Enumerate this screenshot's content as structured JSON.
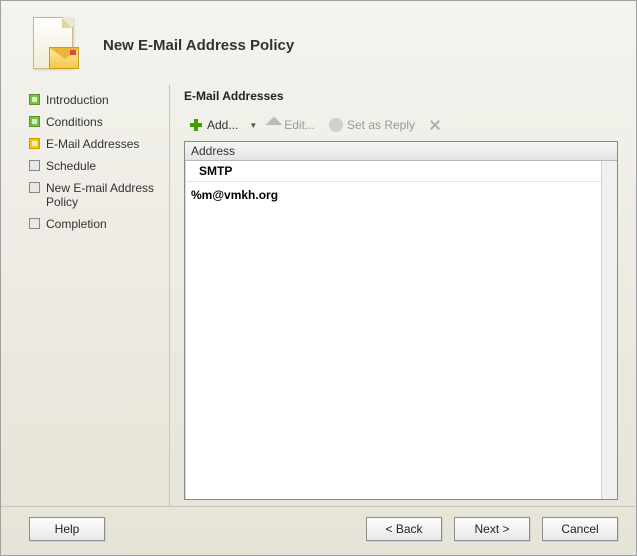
{
  "header": {
    "title": "New E-Mail Address Policy"
  },
  "sidebar": {
    "items": [
      {
        "label": "Introduction",
        "state": "done"
      },
      {
        "label": "Conditions",
        "state": "done"
      },
      {
        "label": "E-Mail Addresses",
        "state": "current"
      },
      {
        "label": "Schedule",
        "state": "todo"
      },
      {
        "label": "New E-mail Address Policy",
        "state": "todo"
      },
      {
        "label": "Completion",
        "state": "todo"
      }
    ]
  },
  "main": {
    "section_title": "E-Mail Addresses",
    "toolbar": {
      "add_label": "Add...",
      "edit_label": "Edit...",
      "reply_label": "Set as Reply"
    },
    "list": {
      "header": "Address",
      "type_row": "SMTP",
      "value_row": "%m@vmkh.org"
    }
  },
  "footer": {
    "help_label": "Help",
    "back_label": "< Back",
    "next_label": "Next >",
    "cancel_label": "Cancel"
  }
}
